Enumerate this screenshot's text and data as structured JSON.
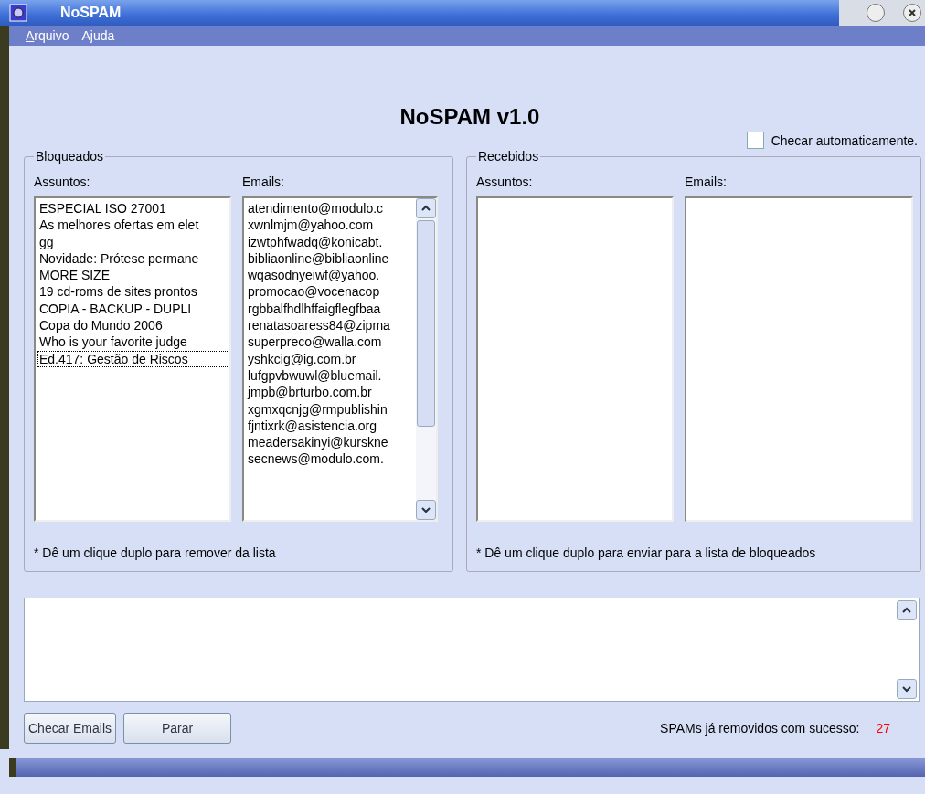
{
  "window": {
    "title": "NoSPAM"
  },
  "menu": [
    {
      "label": "Arquivo",
      "underline_first": true
    },
    {
      "label": "Ajuda",
      "underline_first": false
    }
  ],
  "heading": "NoSPAM v1.0",
  "auto_check": {
    "label": "Checar automaticamente.",
    "checked": false
  },
  "blocked": {
    "title": "Bloqueados",
    "subjects_label": "Assuntos:",
    "emails_label": "Emails:",
    "subjects": [
      {
        "text": "ESPECIAL ISO 27001",
        "selected": false
      },
      {
        "text": "As melhores ofertas em elet",
        "selected": false
      },
      {
        "text": "gg",
        "selected": false
      },
      {
        "text": "Novidade: Prótese permane",
        "selected": false
      },
      {
        "text": "MORE SIZE",
        "selected": false
      },
      {
        "text": "19 cd-roms de sites prontos",
        "selected": false
      },
      {
        "text": "COPIA -  BACKUP - DUPLI",
        "selected": false
      },
      {
        "text": "Copa do Mundo 2006",
        "selected": false
      },
      {
        "text": "Who is your favorite judge",
        "selected": false
      },
      {
        "text": "Ed.417: Gestão de Riscos",
        "selected": true
      }
    ],
    "emails": [
      "atendimento@modulo.c",
      "xwnlmjm@yahoo.com",
      "izwtphfwadq@konicabt.",
      "bibliaonline@bibliaonline",
      "wqasodnyeiwf@yahoo.",
      "promocao@vocenacop",
      "rgbbalfhdlhffaigflegfbaa",
      "renatasoaress84@zipma",
      "superpreco@walla.com",
      "yshkcig@ig.com.br",
      "lufgpvbwuwl@bluemail.",
      "jmpb@brturbo.com.br",
      "xgmxqcnjg@rmpublishin",
      "fjntixrk@asistencia.org",
      "meadersakinyi@kurskne",
      "secnews@modulo.com."
    ],
    "hint": "* Dê um clique duplo para remover da lista"
  },
  "received": {
    "title": "Recebidos",
    "subjects_label": "Assuntos:",
    "emails_label": "Emails:",
    "hint": "* Dê um clique duplo para enviar para a lista de bloqueados"
  },
  "buttons": [
    "Checar Emails",
    "Parar"
  ],
  "removed": {
    "label": "SPAMs já removidos com sucesso:",
    "count": "27"
  }
}
